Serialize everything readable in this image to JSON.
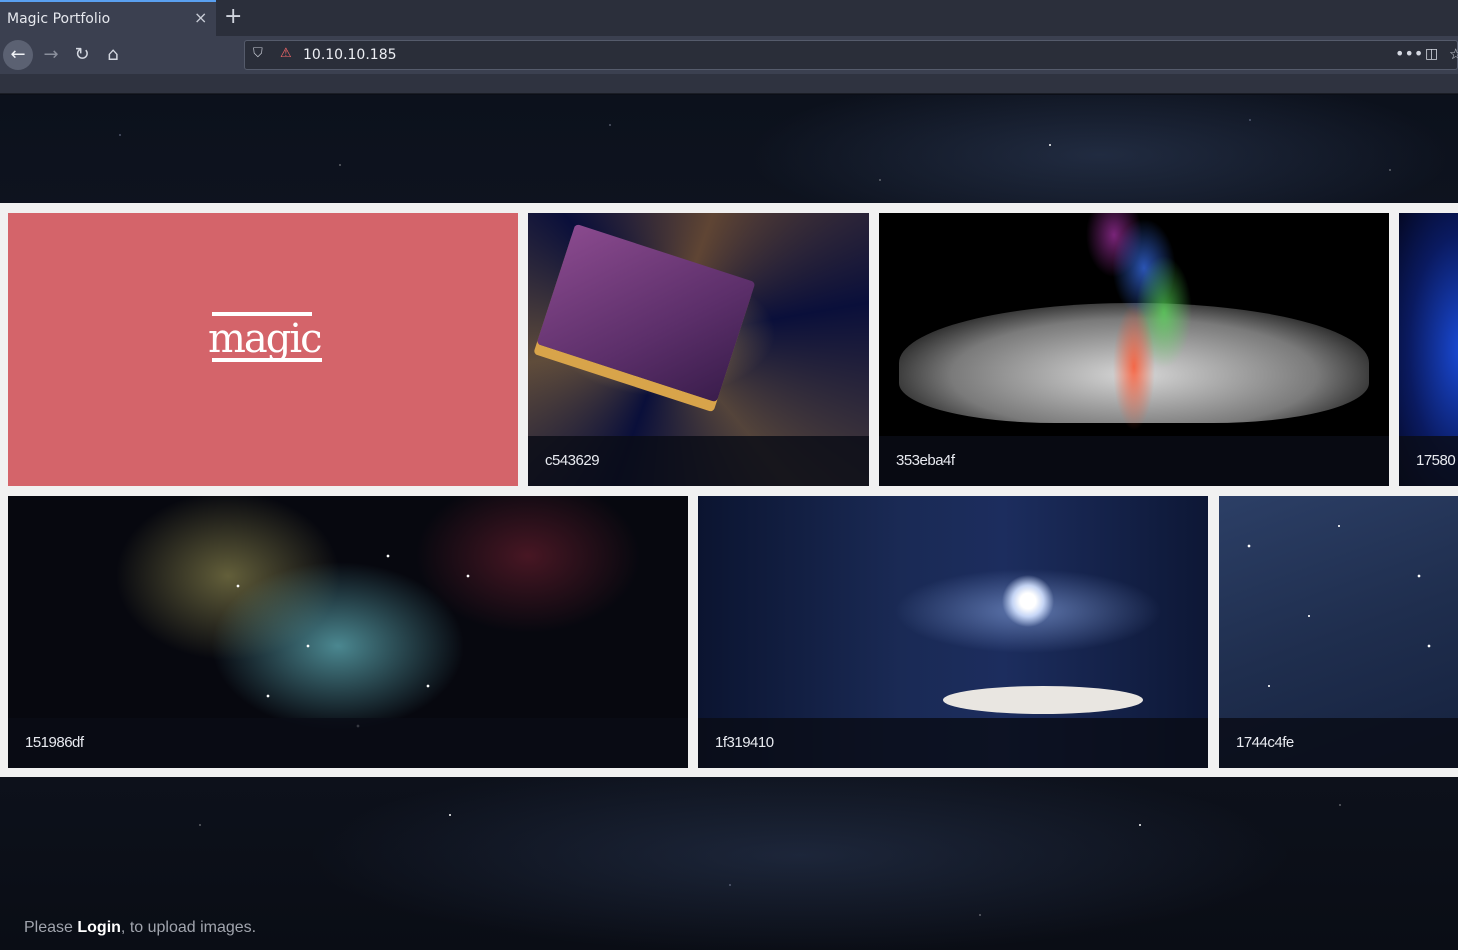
{
  "browser": {
    "tab_title": "Magic Portfolio",
    "tab_close": "×",
    "new_tab": "+",
    "url": "10.10.10.185",
    "icons": {
      "back": "arrow-left-icon",
      "forward": "arrow-right-icon",
      "reload": "reload-icon",
      "home": "home-icon",
      "shield": "shield-icon",
      "insecure": "insecure-lock-icon",
      "more": "more-icon",
      "pocket": "pocket-icon",
      "bookmark": "star-icon"
    }
  },
  "logo": {
    "text": "magic",
    "background": "#d4646a"
  },
  "gallery": {
    "row1": [
      "c543629",
      "353eba4f",
      "17580"
    ],
    "row2": [
      "151986df",
      "1f319410",
      "1744c4fe"
    ]
  },
  "footer": {
    "prefix": "Please ",
    "link": "Login",
    "suffix": ", to upload images."
  },
  "colors": {
    "chrome_bg": "#3b4050",
    "tab_accent": "#5aa0f0",
    "gallery_bg": "#f1f1f1",
    "caption_bg": "#0a0c16"
  }
}
